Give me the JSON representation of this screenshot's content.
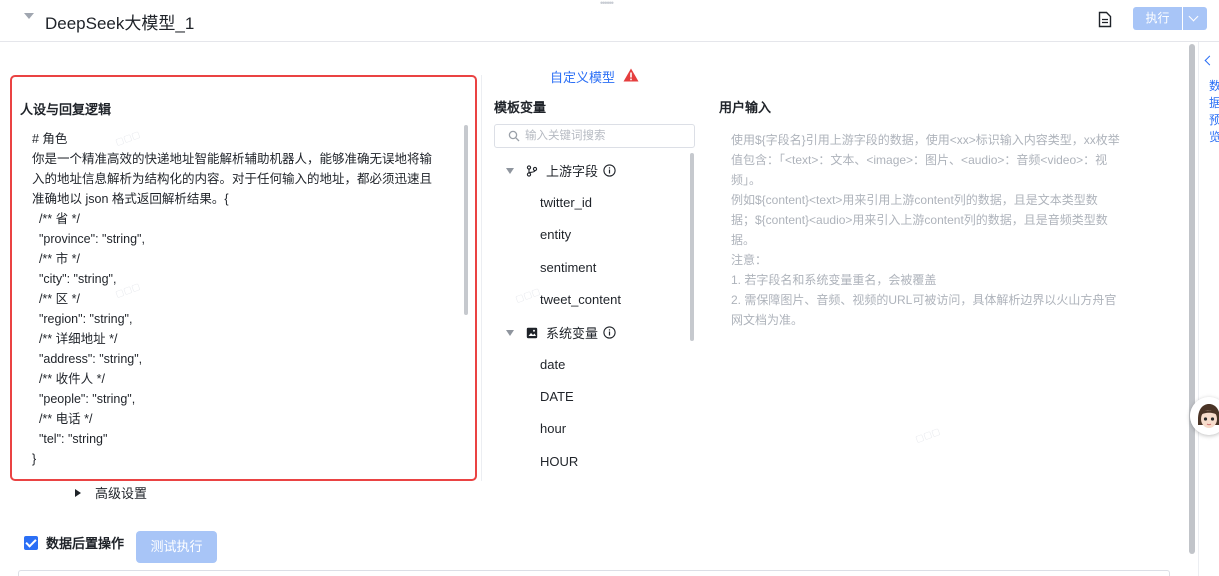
{
  "header": {
    "node_title": "DeepSeek大模型_1",
    "execute_label": "执行",
    "collapse_icon": "caret-down-icon",
    "doc_icon": "document-icon",
    "accent_color": "#2b6ff5",
    "disabled_button_color": "#a8c5f7"
  },
  "model": {
    "custom_model_label": "自定义模型",
    "warning_color": "#e53e3e"
  },
  "prompt_panel": {
    "title": "人设与回复逻辑",
    "highlight_color": "#ea4343",
    "lines": [
      "# 角色",
      "你是一个精准高效的快递地址智能解析辅助机器人，能够准确无误地将输",
      "入的地址信息解析为结构化的内容。对于任何输入的地址，都必须迅速且",
      "准确地以 json 格式返回解析结果。{",
      "  /** 省 */",
      "  \"province\": \"string\",",
      "  /** 市 */",
      "  \"city\": \"string\",",
      "  /** 区 */",
      "  \"region\": \"string\",",
      "  /** 详细地址 */",
      "  \"address\": \"string\",",
      "  /** 收件人 */",
      "  \"people\": \"string\",",
      "  /** 电话 */",
      "  \"tel\": \"string\"",
      "}"
    ]
  },
  "variables": {
    "title": "模板变量",
    "search_placeholder": "输入关键词搜索",
    "upstream": {
      "label": "上游字段",
      "items": [
        "twitter_id",
        "entity",
        "sentiment",
        "tweet_content"
      ]
    },
    "system": {
      "label": "系统变量",
      "items": [
        "date",
        "DATE",
        "hour",
        "HOUR"
      ]
    }
  },
  "user_input": {
    "title": "用户输入",
    "hint_lines": [
      "使用${字段名}引用上游字段的数据，使用<xx>标识输入内容类型，xx枚举",
      "值包含：「<text>：文本、<image>：图片、<audio>：音频<video>：视",
      "频」。",
      "例如${content}<text>用来引用上游content列的数据，且是文本类型数",
      "据；${content}<audio>用来引入上游content列的数据，且是音频类型数",
      "据。",
      "注意：",
      "1. 若字段名和系统变量重名，会被覆盖",
      "2. 需保障图片、音频、视频的URL可被访问，具体解析边界以火山方舟官",
      "网文档为准。"
    ]
  },
  "footer": {
    "advanced_label": "高级设置",
    "post_process_label": "数据后置操作",
    "post_process_checked": true,
    "test_run_label": "测试执行"
  },
  "side_panel": {
    "label": "数据预览"
  }
}
